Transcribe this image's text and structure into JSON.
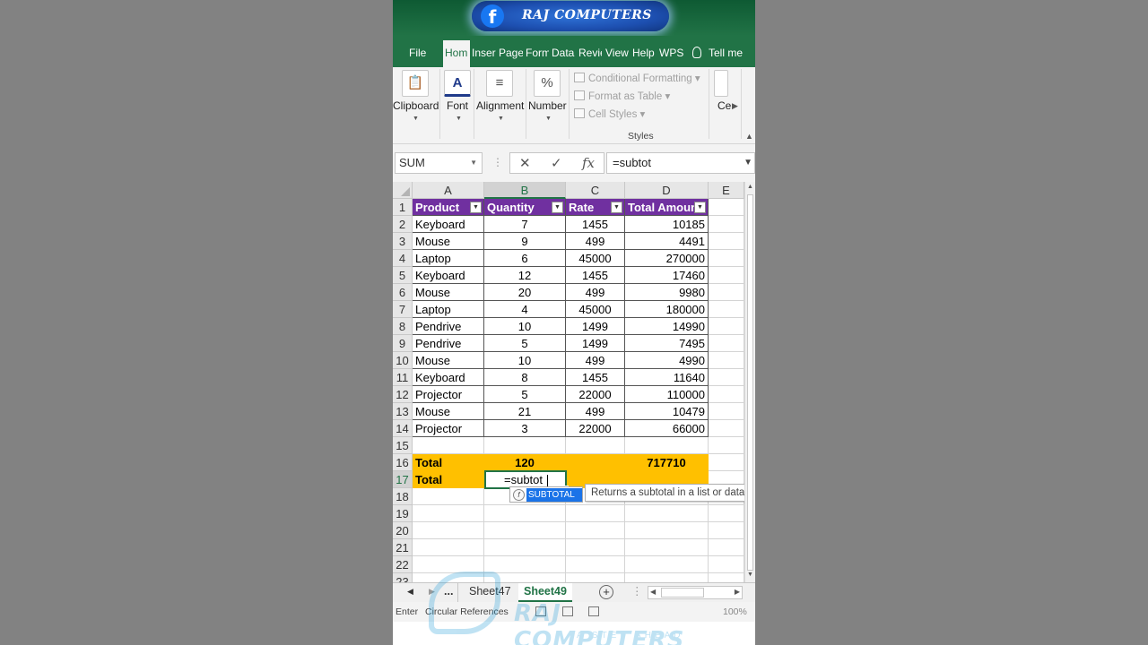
{
  "brand": {
    "channel": "RAJ COMPUTERS",
    "fb_glyph": "f"
  },
  "tabs": [
    "File",
    "Hom",
    "Inser",
    "Page",
    "Form",
    "Data",
    "Revie",
    "View",
    "Help",
    "WPS",
    "Tell me"
  ],
  "ribbon": {
    "clipboard": "Clipboard",
    "font": "Font",
    "alignment": "Alignment",
    "number": "Number",
    "conditional_formatting": "Conditional Formatting",
    "format_as_table": "Format as Table",
    "cell_styles": "Cell Styles",
    "styles_group": "Styles",
    "cells": "Ce"
  },
  "formula_bar": {
    "name_box": "SUM",
    "formula": "=subtot",
    "fx": "fx"
  },
  "grid": {
    "columns": [
      "A",
      "B",
      "C",
      "D",
      "E"
    ],
    "row_numbers": [
      "1",
      "2",
      "3",
      "4",
      "5",
      "6",
      "7",
      "8",
      "9",
      "10",
      "11",
      "12",
      "13",
      "14",
      "15",
      "16",
      "17",
      "18",
      "19",
      "20",
      "21",
      "22",
      "23"
    ],
    "headers": [
      "Product",
      "Quantity",
      "Rate",
      "Total Amount"
    ],
    "rows": [
      [
        "Keyboard",
        "7",
        "1455",
        "10185"
      ],
      [
        "Mouse",
        "9",
        "499",
        "4491"
      ],
      [
        "Laptop",
        "6",
        "45000",
        "270000"
      ],
      [
        "Keyboard",
        "12",
        "1455",
        "17460"
      ],
      [
        "Mouse",
        "20",
        "499",
        "9980"
      ],
      [
        "Laptop",
        "4",
        "45000",
        "180000"
      ],
      [
        "Pendrive",
        "10",
        "1499",
        "14990"
      ],
      [
        "Pendrive",
        "5",
        "1499",
        "7495"
      ],
      [
        "Mouse",
        "10",
        "499",
        "4990"
      ],
      [
        "Keyboard",
        "8",
        "1455",
        "11640"
      ],
      [
        "Projector",
        "5",
        "22000",
        "110000"
      ],
      [
        "Mouse",
        "21",
        "499",
        "10479"
      ],
      [
        "Projector",
        "3",
        "22000",
        "66000"
      ]
    ],
    "total_row": {
      "label": "Total",
      "quantity": "120",
      "amount": "717710"
    },
    "editing_row": {
      "label": "Total",
      "value": "=subtot"
    }
  },
  "autocomplete": {
    "item": "SUBTOTAL",
    "tooltip": "Returns a subtotal in a list or databa"
  },
  "sheets": {
    "ellipsis": "...",
    "tab1": "Sheet47",
    "tab2": "Sheet49",
    "add": "+"
  },
  "status": {
    "mode": "Enter",
    "circular": "Circular References",
    "zoom": "100%"
  },
  "watermark": {
    "text": "RAJ COMPUTERS",
    "tagline": "A STEP AHEAD"
  },
  "colors": {
    "excel_green": "#217346",
    "header_purple": "#7030a0",
    "total_yellow": "#ffc000"
  }
}
